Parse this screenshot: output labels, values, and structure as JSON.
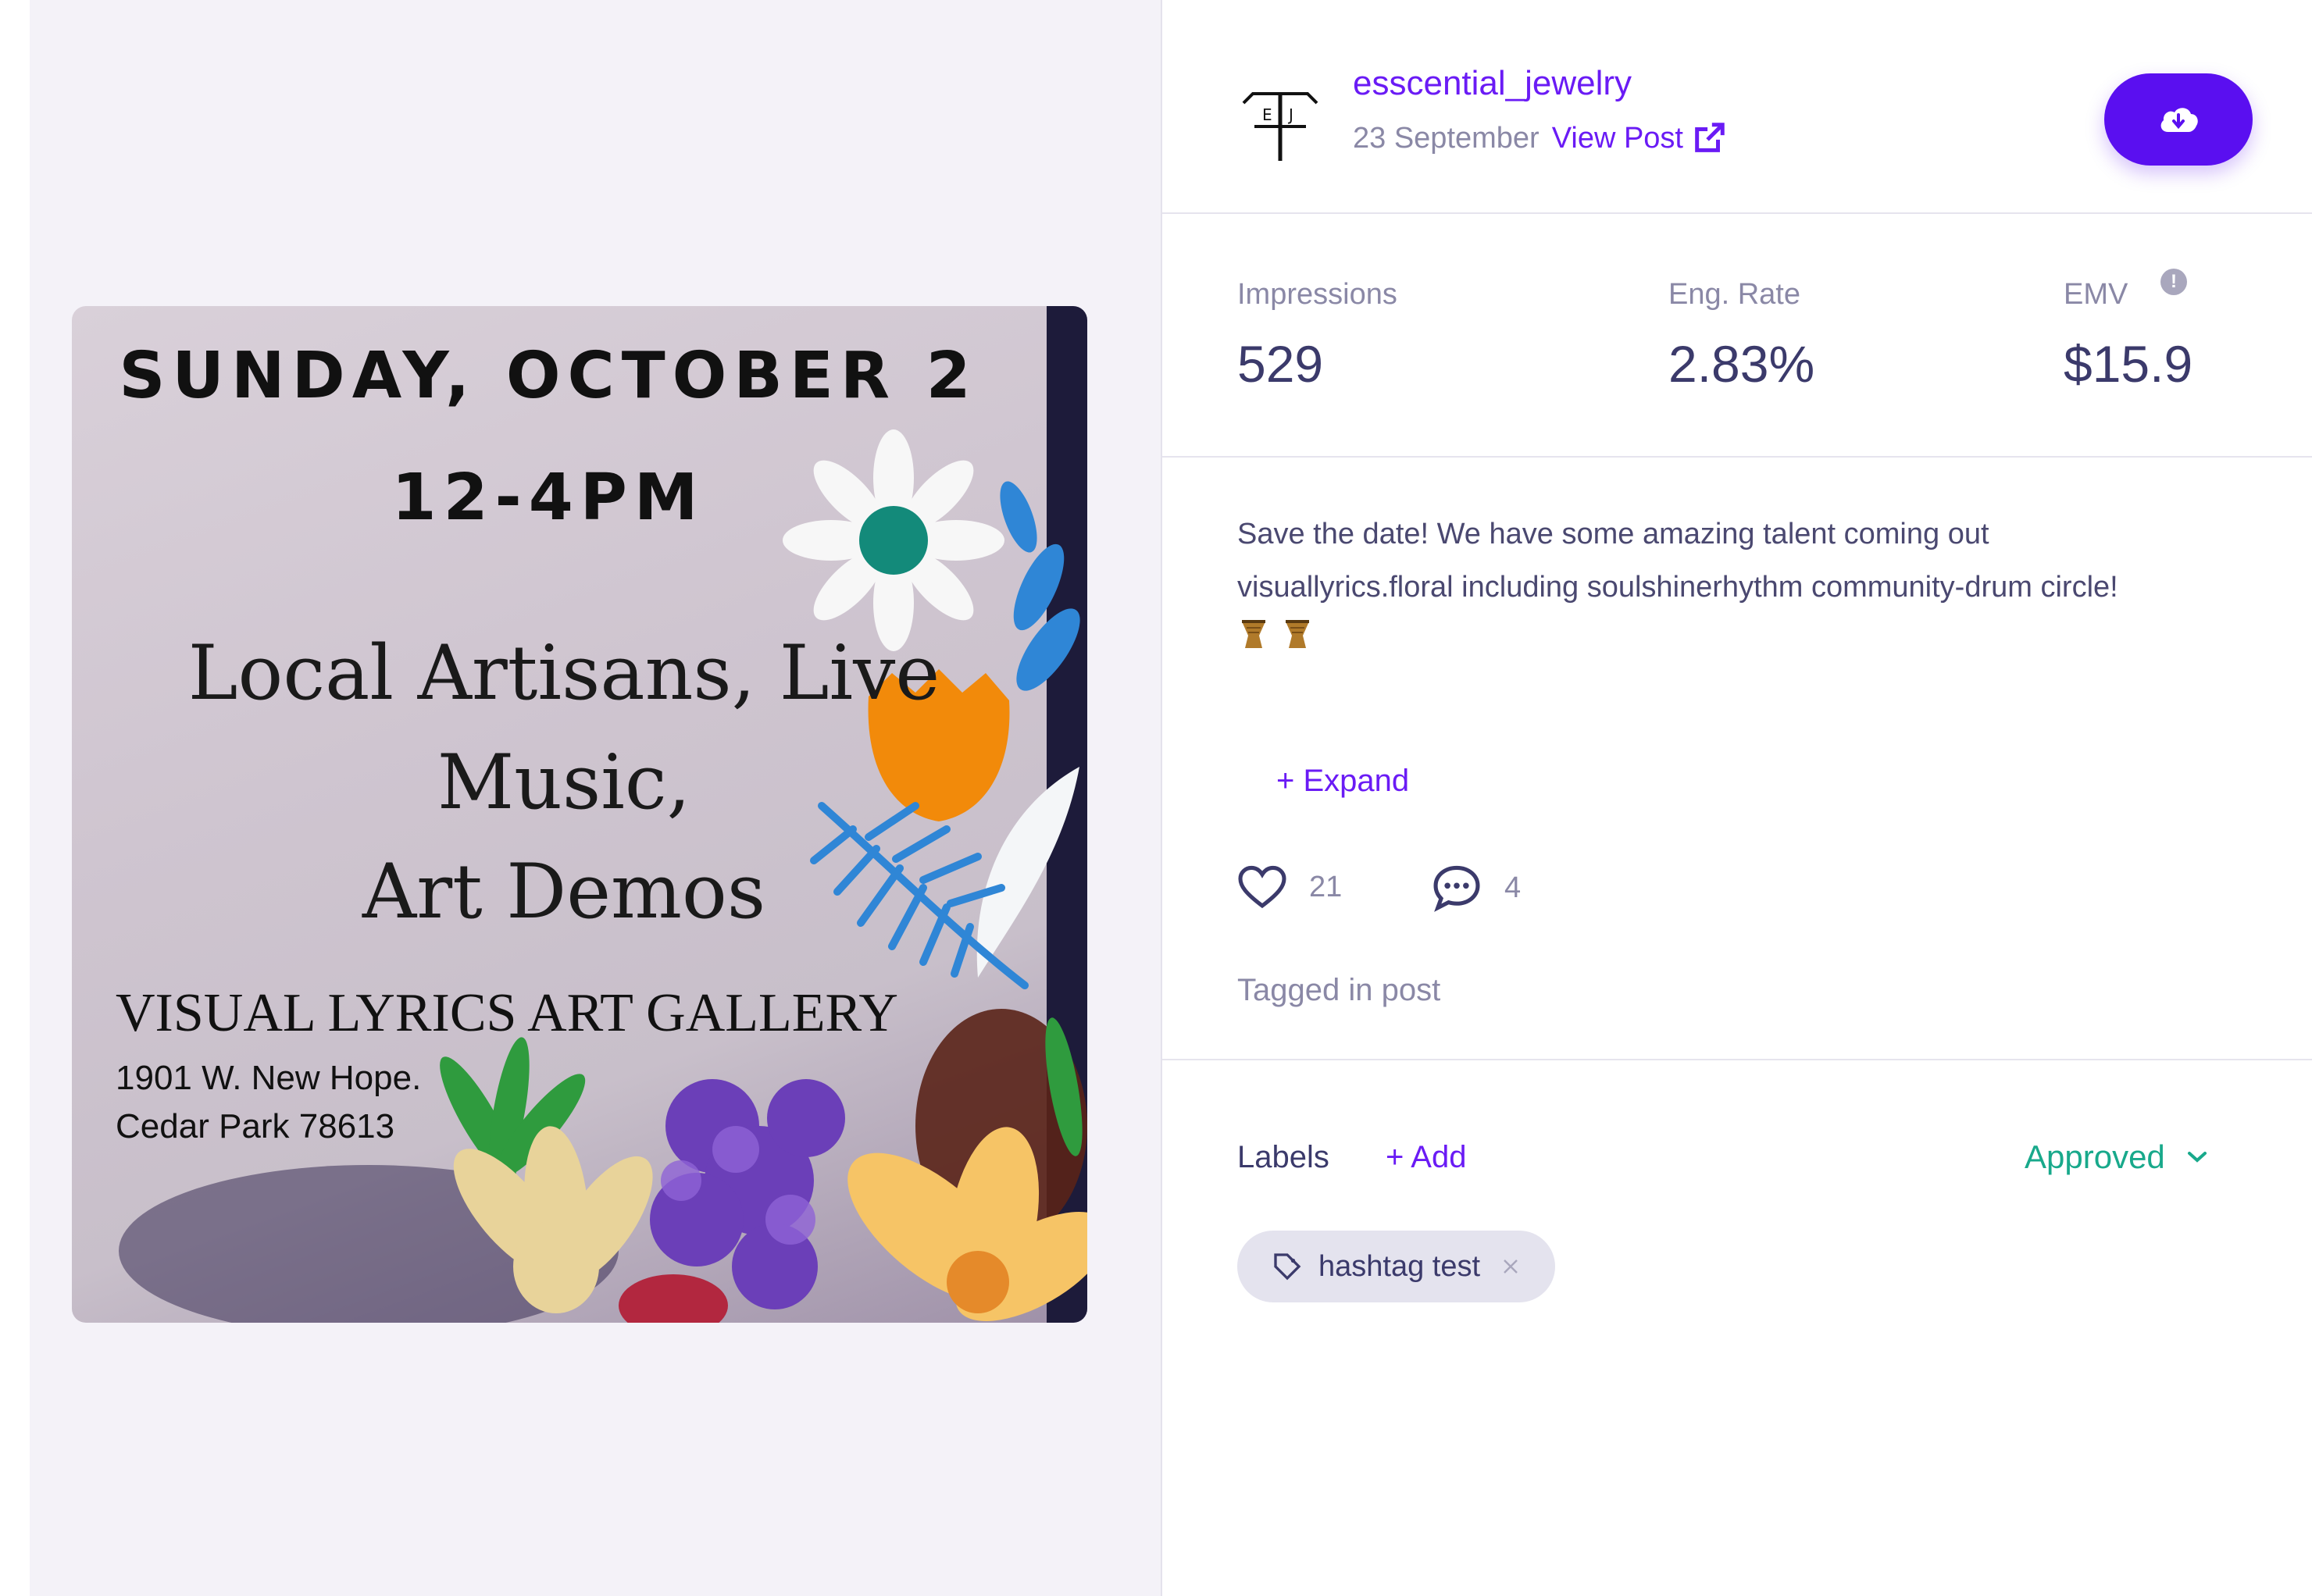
{
  "post": {
    "image_text": {
      "date_line": "SUNDAY, OCTOBER 2",
      "time_line": "12-4PM",
      "headline_lines": [
        "Local Artisans, Live",
        "Music,",
        "Art Demos"
      ],
      "gallery": "VISUAL LYRICS ART GALLERY",
      "address": "1901 W. New Hope.\nCedar Park 78613"
    }
  },
  "header": {
    "avatar_letters": "E J",
    "username": "esscential_jewelry",
    "date": "23 September",
    "view_post_label": "View Post",
    "download_icon": "cloud-download-icon"
  },
  "stats": {
    "impressions_label": "Impressions",
    "impressions_value": "529",
    "eng_rate_label": "Eng. Rate",
    "eng_rate_value": "2.83%",
    "emv_label": "EMV",
    "emv_value": "$15.9",
    "emv_info_icon": "info-icon"
  },
  "caption": {
    "line1": "Save the date! We have some amazing talent coming out",
    "line2": "visuallyrics.floral including soulshinerhythm community-drum circle!",
    "emojis": [
      "drum-emoji",
      "drum-emoji"
    ],
    "expand_label": "+ Expand"
  },
  "engagement": {
    "likes": "21",
    "comments": "4",
    "tagged_label": "Tagged in post"
  },
  "labels": {
    "title": "Labels",
    "add_label": "+ Add",
    "status": "Approved",
    "chips": [
      "hashtag test"
    ]
  },
  "colors": {
    "accent": "#5a0ff0",
    "link": "#6a1bf5",
    "approved": "#18a98b",
    "muted": "#8a88a6",
    "text": "#3b3a6b"
  }
}
